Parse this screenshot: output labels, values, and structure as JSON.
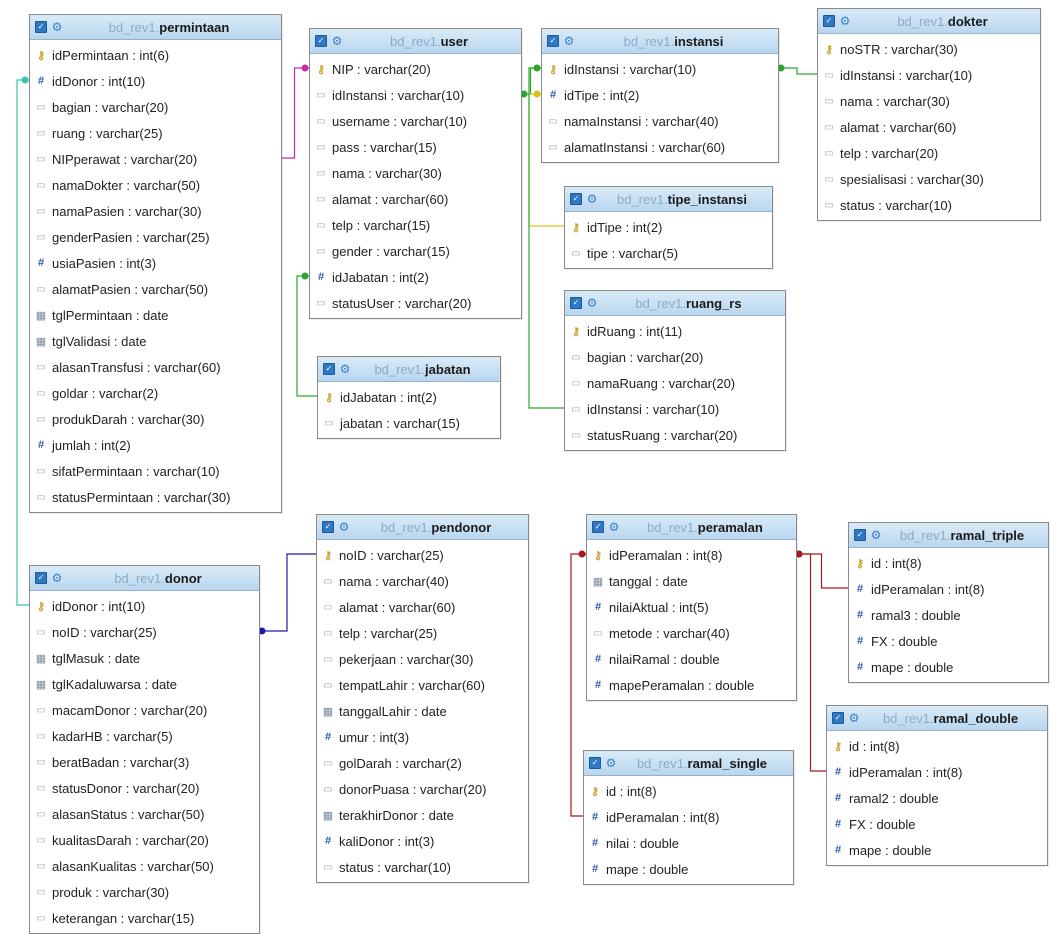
{
  "schema_prefix": "bd_rev1.",
  "tables": {
    "permintaan": {
      "name": "permintaan",
      "columns": [
        {
          "label": "idPermintaan : int(6)",
          "icon": "key"
        },
        {
          "label": "idDonor : int(10)",
          "icon": "num"
        },
        {
          "label": "bagian : varchar(20)",
          "icon": "str"
        },
        {
          "label": "ruang : varchar(25)",
          "icon": "str"
        },
        {
          "label": "NIPperawat : varchar(20)",
          "icon": "str"
        },
        {
          "label": "namaDokter : varchar(50)",
          "icon": "str"
        },
        {
          "label": "namaPasien : varchar(30)",
          "icon": "str"
        },
        {
          "label": "genderPasien : varchar(25)",
          "icon": "str"
        },
        {
          "label": "usiaPasien : int(3)",
          "icon": "num"
        },
        {
          "label": "alamatPasien : varchar(50)",
          "icon": "str"
        },
        {
          "label": "tglPermintaan : date",
          "icon": "date"
        },
        {
          "label": "tglValidasi : date",
          "icon": "date"
        },
        {
          "label": "alasanTransfusi : varchar(60)",
          "icon": "str"
        },
        {
          "label": "goldar : varchar(2)",
          "icon": "str"
        },
        {
          "label": "produkDarah : varchar(30)",
          "icon": "str"
        },
        {
          "label": "jumlah : int(2)",
          "icon": "num"
        },
        {
          "label": "sifatPermintaan : varchar(10)",
          "icon": "str"
        },
        {
          "label": "statusPermintaan : varchar(30)",
          "icon": "str"
        }
      ]
    },
    "user": {
      "name": "user",
      "columns": [
        {
          "label": "NIP : varchar(20)",
          "icon": "key"
        },
        {
          "label": "idInstansi : varchar(10)",
          "icon": "str"
        },
        {
          "label": "username : varchar(10)",
          "icon": "str"
        },
        {
          "label": "pass : varchar(15)",
          "icon": "str"
        },
        {
          "label": "nama : varchar(30)",
          "icon": "str"
        },
        {
          "label": "alamat : varchar(60)",
          "icon": "str"
        },
        {
          "label": "telp : varchar(15)",
          "icon": "str"
        },
        {
          "label": "gender : varchar(15)",
          "icon": "str"
        },
        {
          "label": "idJabatan : int(2)",
          "icon": "num"
        },
        {
          "label": "statusUser : varchar(20)",
          "icon": "str"
        }
      ]
    },
    "instansi": {
      "name": "instansi",
      "columns": [
        {
          "label": "idInstansi : varchar(10)",
          "icon": "key"
        },
        {
          "label": "idTipe : int(2)",
          "icon": "num"
        },
        {
          "label": "namaInstansi : varchar(40)",
          "icon": "str"
        },
        {
          "label": "alamatInstansi : varchar(60)",
          "icon": "str"
        }
      ]
    },
    "dokter": {
      "name": "dokter",
      "columns": [
        {
          "label": "noSTR : varchar(30)",
          "icon": "key"
        },
        {
          "label": "idInstansi : varchar(10)",
          "icon": "str"
        },
        {
          "label": "nama : varchar(30)",
          "icon": "str"
        },
        {
          "label": "alamat : varchar(60)",
          "icon": "str"
        },
        {
          "label": "telp : varchar(20)",
          "icon": "str"
        },
        {
          "label": "spesialisasi : varchar(30)",
          "icon": "str"
        },
        {
          "label": "status : varchar(10)",
          "icon": "str"
        }
      ]
    },
    "tipe_instansi": {
      "name": "tipe_instansi",
      "columns": [
        {
          "label": "idTipe : int(2)",
          "icon": "key"
        },
        {
          "label": "tipe : varchar(5)",
          "icon": "str"
        }
      ]
    },
    "ruang_rs": {
      "name": "ruang_rs",
      "columns": [
        {
          "label": "idRuang : int(11)",
          "icon": "key"
        },
        {
          "label": "bagian : varchar(20)",
          "icon": "str"
        },
        {
          "label": "namaRuang : varchar(20)",
          "icon": "str"
        },
        {
          "label": "idInstansi : varchar(10)",
          "icon": "str"
        },
        {
          "label": "statusRuang : varchar(20)",
          "icon": "str"
        }
      ]
    },
    "jabatan": {
      "name": "jabatan",
      "columns": [
        {
          "label": "idJabatan : int(2)",
          "icon": "key"
        },
        {
          "label": "jabatan : varchar(15)",
          "icon": "str"
        }
      ]
    },
    "donor": {
      "name": "donor",
      "columns": [
        {
          "label": "idDonor : int(10)",
          "icon": "key"
        },
        {
          "label": "noID : varchar(25)",
          "icon": "str"
        },
        {
          "label": "tglMasuk : date",
          "icon": "date"
        },
        {
          "label": "tglKadaluwarsa : date",
          "icon": "date"
        },
        {
          "label": "macamDonor : varchar(20)",
          "icon": "str"
        },
        {
          "label": "kadarHB : varchar(5)",
          "icon": "str"
        },
        {
          "label": "beratBadan : varchar(3)",
          "icon": "str"
        },
        {
          "label": "statusDonor : varchar(20)",
          "icon": "str"
        },
        {
          "label": "alasanStatus : varchar(50)",
          "icon": "str"
        },
        {
          "label": "kualitasDarah : varchar(20)",
          "icon": "str"
        },
        {
          "label": "alasanKualitas : varchar(50)",
          "icon": "str"
        },
        {
          "label": "produk : varchar(30)",
          "icon": "str"
        },
        {
          "label": "keterangan : varchar(15)",
          "icon": "str"
        }
      ]
    },
    "pendonor": {
      "name": "pendonor",
      "columns": [
        {
          "label": "noID : varchar(25)",
          "icon": "key"
        },
        {
          "label": "nama : varchar(40)",
          "icon": "str"
        },
        {
          "label": "alamat : varchar(60)",
          "icon": "str"
        },
        {
          "label": "telp : varchar(25)",
          "icon": "str"
        },
        {
          "label": "pekerjaan : varchar(30)",
          "icon": "str"
        },
        {
          "label": "tempatLahir : varchar(60)",
          "icon": "str"
        },
        {
          "label": "tanggalLahir : date",
          "icon": "date"
        },
        {
          "label": "umur : int(3)",
          "icon": "num"
        },
        {
          "label": "golDarah : varchar(2)",
          "icon": "str"
        },
        {
          "label": "donorPuasa : varchar(20)",
          "icon": "str"
        },
        {
          "label": "terakhirDonor : date",
          "icon": "date"
        },
        {
          "label": "kaliDonor : int(3)",
          "icon": "num"
        },
        {
          "label": "status : varchar(10)",
          "icon": "str"
        }
      ]
    },
    "peramalan": {
      "name": "peramalan",
      "columns": [
        {
          "label": "idPeramalan : int(8)",
          "icon": "key"
        },
        {
          "label": "tanggal : date",
          "icon": "date"
        },
        {
          "label": "nilaiAktual : int(5)",
          "icon": "num"
        },
        {
          "label": "metode : varchar(40)",
          "icon": "str"
        },
        {
          "label": "nilaiRamal : double",
          "icon": "num"
        },
        {
          "label": "mapePeramalan : double",
          "icon": "num"
        }
      ]
    },
    "ramal_triple": {
      "name": "ramal_triple",
      "columns": [
        {
          "label": "id : int(8)",
          "icon": "key"
        },
        {
          "label": "idPeramalan : int(8)",
          "icon": "num"
        },
        {
          "label": "ramal3 : double",
          "icon": "num"
        },
        {
          "label": "FX : double",
          "icon": "num"
        },
        {
          "label": "mape : double",
          "icon": "num"
        }
      ]
    },
    "ramal_double": {
      "name": "ramal_double",
      "columns": [
        {
          "label": "id : int(8)",
          "icon": "key"
        },
        {
          "label": "idPeramalan : int(8)",
          "icon": "num"
        },
        {
          "label": "ramal2 : double",
          "icon": "num"
        },
        {
          "label": "FX : double",
          "icon": "num"
        },
        {
          "label": "mape : double",
          "icon": "num"
        }
      ]
    },
    "ramal_single": {
      "name": "ramal_single",
      "columns": [
        {
          "label": "id : int(8)",
          "icon": "key"
        },
        {
          "label": "idPeramalan : int(8)",
          "icon": "num"
        },
        {
          "label": "nilai : double",
          "icon": "num"
        },
        {
          "label": "mape : double",
          "icon": "num"
        }
      ]
    }
  },
  "relations": [
    {
      "from": "permintaan.idDonor",
      "to": "donor.idDonor",
      "color": "#3cc4b0"
    },
    {
      "from": "user.NIP",
      "to": "permintaan.NIPperawat",
      "color": "#c42aa8"
    },
    {
      "from": "user.idInstansi",
      "to": "instansi.idInstansi",
      "color": "#2aa82a"
    },
    {
      "from": "user.idJabatan",
      "to": "jabatan.idJabatan",
      "color": "#2aa82a"
    },
    {
      "from": "instansi.idTipe",
      "to": "tipe_instansi.idTipe",
      "color": "#d8c21c"
    },
    {
      "from": "instansi.idInstansi",
      "to": "dokter.idInstansi",
      "color": "#2aa82a"
    },
    {
      "from": "instansi.idInstansi",
      "to": "ruang_rs.idInstansi",
      "color": "#2aa82a"
    },
    {
      "from": "donor.noID",
      "to": "pendonor.noID",
      "color": "#1a1aa8"
    },
    {
      "from": "peramalan.idPeramalan",
      "to": "ramal_triple.idPeramalan",
      "color": "#a81a1a"
    },
    {
      "from": "peramalan.idPeramalan",
      "to": "ramal_double.idPeramalan",
      "color": "#a81a1a"
    },
    {
      "from": "peramalan.idPeramalan",
      "to": "ramal_single.idPeramalan",
      "color": "#a81a1a"
    }
  ]
}
